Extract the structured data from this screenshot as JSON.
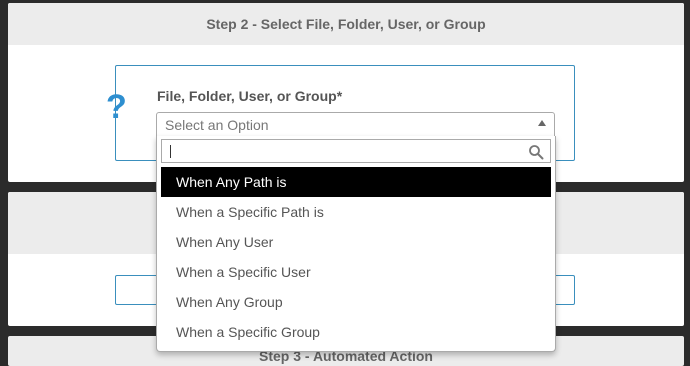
{
  "step2": {
    "header": "Step 2 - Select File, Folder, User, or Group",
    "help_icon": "question-mark-icon",
    "field_label": "File, Folder, User, or Group*",
    "select_placeholder": "Select an Option"
  },
  "step3": {
    "header": "Step 3 - Automated Action"
  },
  "dropdown": {
    "search_value": "",
    "search_icon": "magnifier-icon",
    "options": [
      {
        "label": "When Any Path is",
        "highlighted": true
      },
      {
        "label": "When a Specific Path is",
        "highlighted": false
      },
      {
        "label": "When Any User",
        "highlighted": false
      },
      {
        "label": "When a Specific User",
        "highlighted": false
      },
      {
        "label": "When Any Group",
        "highlighted": false
      },
      {
        "label": "When a Specific Group",
        "highlighted": false
      }
    ]
  },
  "colors": {
    "accent_blue": "#2e8fd0",
    "field_border": "#3a8fbd",
    "highlight_bg": "#000000",
    "page_bg": "#2b2b2b"
  }
}
